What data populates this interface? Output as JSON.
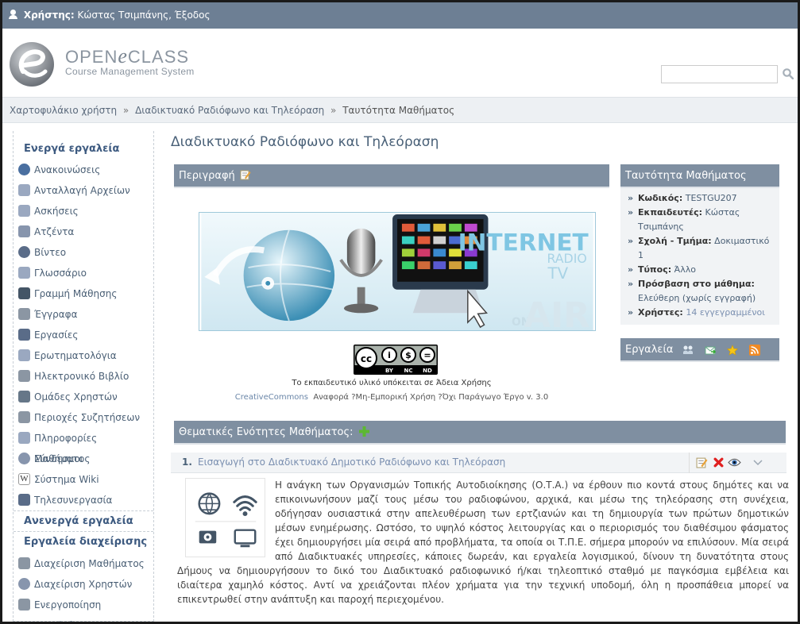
{
  "topbar": {
    "user_label": "Χρήστης:",
    "user_name": "Κώστας Τσιμπάνης",
    "sep": ",",
    "logout": "Έξοδος"
  },
  "header": {
    "logo_main": "OPEN",
    "logo_e": "e",
    "logo_class": "CLASS",
    "logo_sub": "Course Management System",
    "search_placeholder": ""
  },
  "breadcrumb": {
    "home": "Χαρτοφυλάκιο χρήστη",
    "course": "Διαδικτυακό Ραδιόφωνο και Τηλεόραση",
    "current": "Ταυτότητα Μαθήματος",
    "sep": "»"
  },
  "sidebar": {
    "active_title": "Ενεργά εργαλεία",
    "active": [
      {
        "label": "Ανακοινώσεις",
        "icon": "announcements-icon"
      },
      {
        "label": "Ανταλλαγή Αρχείων",
        "icon": "file-exchange-icon"
      },
      {
        "label": "Ασκήσεις",
        "icon": "exercises-icon"
      },
      {
        "label": "Ατζέντα",
        "icon": "calendar-icon"
      },
      {
        "label": "Βίντεο",
        "icon": "video-icon"
      },
      {
        "label": "Γλωσσάριο",
        "icon": "glossary-icon"
      },
      {
        "label": "Γραμμή Μάθησης",
        "icon": "footprints-icon"
      },
      {
        "label": "Έγγραφα",
        "icon": "documents-icon"
      },
      {
        "label": "Εργασίες",
        "icon": "assignments-icon"
      },
      {
        "label": "Ερωτηματολόγια",
        "icon": "questionnaire-icon"
      },
      {
        "label": "Ηλεκτρονικό Βιβλίο",
        "icon": "ebook-icon"
      },
      {
        "label": "Ομάδες Χρηστών",
        "icon": "groups-icon"
      },
      {
        "label": "Περιοχές Συζητήσεων",
        "icon": "forum-icon"
      },
      {
        "label": "Πληροφορίες Μαθήματος",
        "icon": "tag-icon"
      },
      {
        "label": "Σύνδεσμοι",
        "icon": "links-icon"
      },
      {
        "label": "Σύστημα Wiki",
        "icon": "wiki-icon"
      },
      {
        "label": "Τηλεσυνεργασία",
        "icon": "teleconference-icon"
      }
    ],
    "inactive_title": "Ανενεργά εργαλεία",
    "admin_title": "Εργαλεία διαχείρισης",
    "admin": [
      {
        "label": "Διαχείριση Μαθήματος",
        "icon": "tools-icon"
      },
      {
        "label": "Διαχείριση Χρηστών",
        "icon": "users-icon"
      },
      {
        "label": "Ενεργοποίηση Εργαλείων",
        "icon": "wand-icon"
      }
    ]
  },
  "main": {
    "title": "Διαδικτυακό Ραδιόφωνο και Τηλεόραση",
    "description_header": "Περιγραφή",
    "banner": {
      "internet": "INTERNET",
      "radio": "RADIO",
      "tv": "TV",
      "on": "ON",
      "air": "AIR"
    },
    "license_text": "Το εκπαιδευτικό υλικό υπόκειται σε Άδεια Χρήσης",
    "license_link": "CreativeCommons",
    "license_detail": "Αναφορά ?Μη-Εμπορική Χρήση ?Όχι Παράγωγο Έργο v. 3.0",
    "cc_badges": [
      "BY",
      "NC",
      "ND"
    ]
  },
  "info": {
    "header": "Ταυτότητα Μαθήματος",
    "items": [
      {
        "label": "Κωδικός:",
        "value": "TESTGU207"
      },
      {
        "label": "Εκπαιδευτές:",
        "value": "Κώστας Τσιμπάνης"
      },
      {
        "label": "Σχολή - Τμήμα:",
        "value": "Δοκιμαστικό 1"
      },
      {
        "label": "Τύπος:",
        "value": "Άλλο"
      },
      {
        "label": "Πρόσβαση στο μάθημα:",
        "value": "Ελεύθερη (χωρίς εγγραφή)"
      },
      {
        "label": "Χρήστες:",
        "value": "14 εγγεγραμμένοι"
      }
    ],
    "tools_header": "Εργαλεία"
  },
  "topics": {
    "header": "Θεματικές Ενότητες Μαθήματος:",
    "num": "1.",
    "title": "Εισαγωγή στο Διαδικτυακό Δημοτικό Ραδιόφωνο και Τηλεόραση",
    "body": "Η ανάγκη των Οργανισμών Τοπικής Αυτοδιοίκησης (Ο.Τ.Α.) να έρθουν πιο κοντά στους δημότες και να επικοινωνήσουν μαζί τους μέσω του ραδιοφώνου, αρχικά, και μέσω της τηλεόρασης στη συνέχεια, οδήγησαν ουσιαστικά στην απελευθέρωση των ερτζιανών και τη δημιουργία των πρώτων δημοτικών μέσων ενημέρωσης. Ωστόσο, το υψηλό κόστος λειτουργίας και ο περιορισμός του διαθέσιμου φάσματος έχει δημιουργήσει μία σειρά από προβλήματα, τα οποία οι Τ.Π.Ε. σήμερα μπορούν να επιλύσουν. Μία σειρά από Διαδικτυακές υπηρεσίες, κάποιες δωρεάν, και εργαλεία λογισμικού, δίνουν τη δυνατότητα στους Δήμους να δημιουργήσουν το δικό του Διαδικτυακό ραδιοφωνικό ή/και τηλεοπτικό σταθμό με παγκόσμια εμβέλεια και ιδιαίτερα χαμηλό κόστος. Αντί να χρειάζονται πλέον χρήματα για την τεχνική υποδομή, όλη η προσπάθεια μπορεί να επικεντρωθεί στην ανάπτυξη και παροχή περιεχομένου."
  },
  "colors": {
    "topbar": "#6d7f94",
    "panel_header": "#7f8fa1",
    "link": "#5b6a7c",
    "heading": "#3d5a80"
  }
}
